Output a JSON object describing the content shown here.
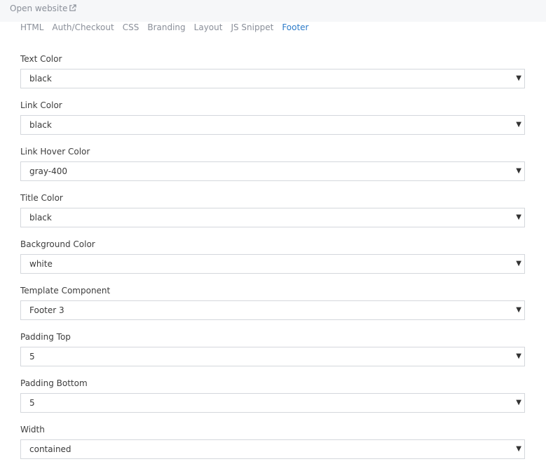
{
  "header": {
    "open_website_label": "Open website",
    "open_icon": "external-link-icon"
  },
  "tabs": [
    {
      "label": "HTML",
      "active": false
    },
    {
      "label": "Auth/Checkout",
      "active": false
    },
    {
      "label": "CSS",
      "active": false
    },
    {
      "label": "Branding",
      "active": false
    },
    {
      "label": "Layout",
      "active": false
    },
    {
      "label": "JS Snippet",
      "active": false
    },
    {
      "label": "Footer",
      "active": true
    }
  ],
  "fields": [
    {
      "label": "Text Color",
      "value": "black"
    },
    {
      "label": "Link Color",
      "value": "black"
    },
    {
      "label": "Link Hover Color",
      "value": "gray-400"
    },
    {
      "label": "Title Color",
      "value": "black"
    },
    {
      "label": "Background Color",
      "value": "white"
    },
    {
      "label": "Template Component",
      "value": "Footer 3"
    },
    {
      "label": "Padding Top",
      "value": "5"
    },
    {
      "label": "Padding Bottom",
      "value": "5"
    },
    {
      "label": "Width",
      "value": "contained"
    }
  ],
  "colors": {
    "active_tab": "#2c7bc9",
    "muted_text": "#8a8f99",
    "topbar_bg": "#f6f7f9",
    "border": "#d4d7dc"
  }
}
